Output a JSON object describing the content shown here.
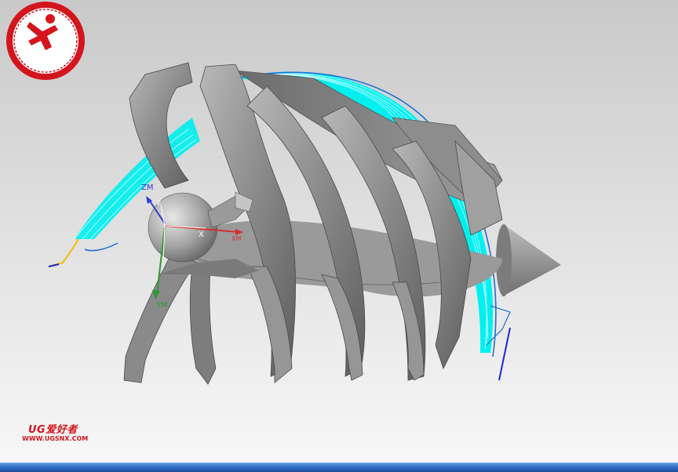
{
  "viewport": {
    "axes": {
      "zm_label": "ZM",
      "x_label": "X",
      "xm_label": "XM",
      "ym_label": "YM",
      "z_label": "Z"
    }
  },
  "watermark": {
    "brand": "UG爱好者",
    "url": "WWW.UGSNX.COM"
  },
  "colors": {
    "toolpath": "#00f0f0",
    "part": "#8e8e8e",
    "axis_z": "#2a3bd6",
    "axis_x": "#d43030",
    "axis_y": "#2f9a2f",
    "logo": "#d4151d"
  }
}
